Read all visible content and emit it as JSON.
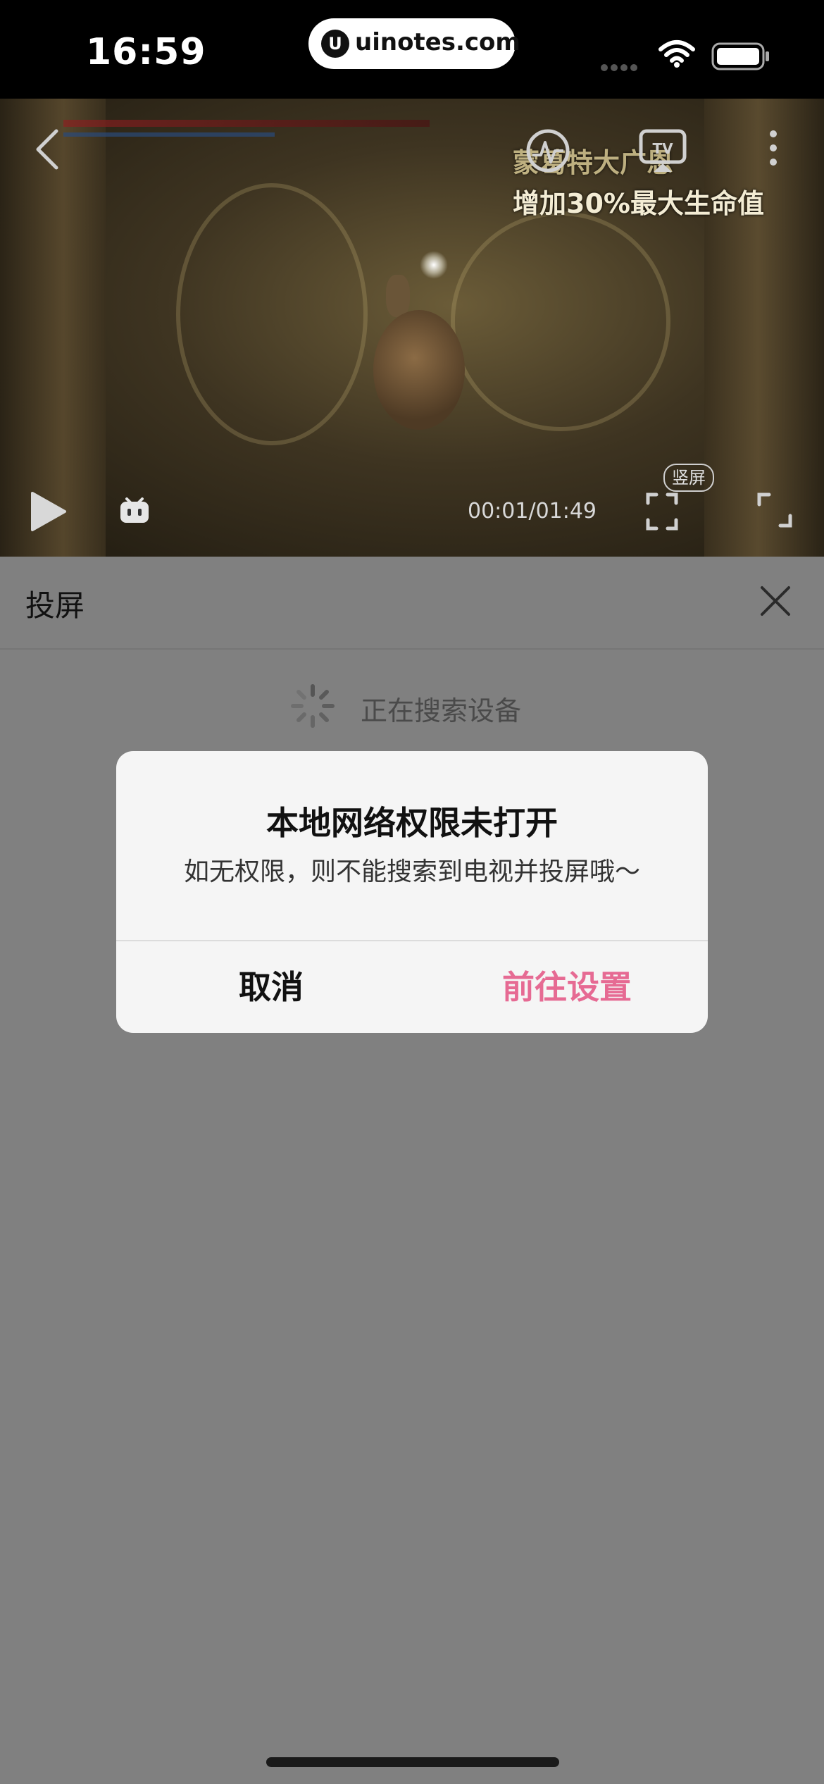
{
  "status_bar": {
    "time": "16:59",
    "url": "uinotes.com",
    "url_logo": "U",
    "icons": [
      "cellular-dots-icon",
      "wifi-icon",
      "battery-icon"
    ]
  },
  "video": {
    "overlay_line1": "蒙葛特大广恩",
    "overlay_line2": "增加30%最大生命值",
    "current_time": "00:01/01:49",
    "portrait_label": "竖屏",
    "icons": [
      "back-icon",
      "pulse-icon",
      "tv-cast-icon",
      "more-icon",
      "play-icon",
      "danmaku-icon",
      "screenshot-icon",
      "fullscreen-icon"
    ]
  },
  "cast_panel": {
    "title": "投屏",
    "searching_text": "正在搜索设备",
    "icons": [
      "close-icon",
      "spinner-icon"
    ]
  },
  "dialog": {
    "title": "本地网络权限未打开",
    "message": "如无权限，则不能搜索到电视并投屏哦～",
    "cancel_label": "取消",
    "confirm_label": "前往设置",
    "confirm_color": "#e66a93"
  }
}
